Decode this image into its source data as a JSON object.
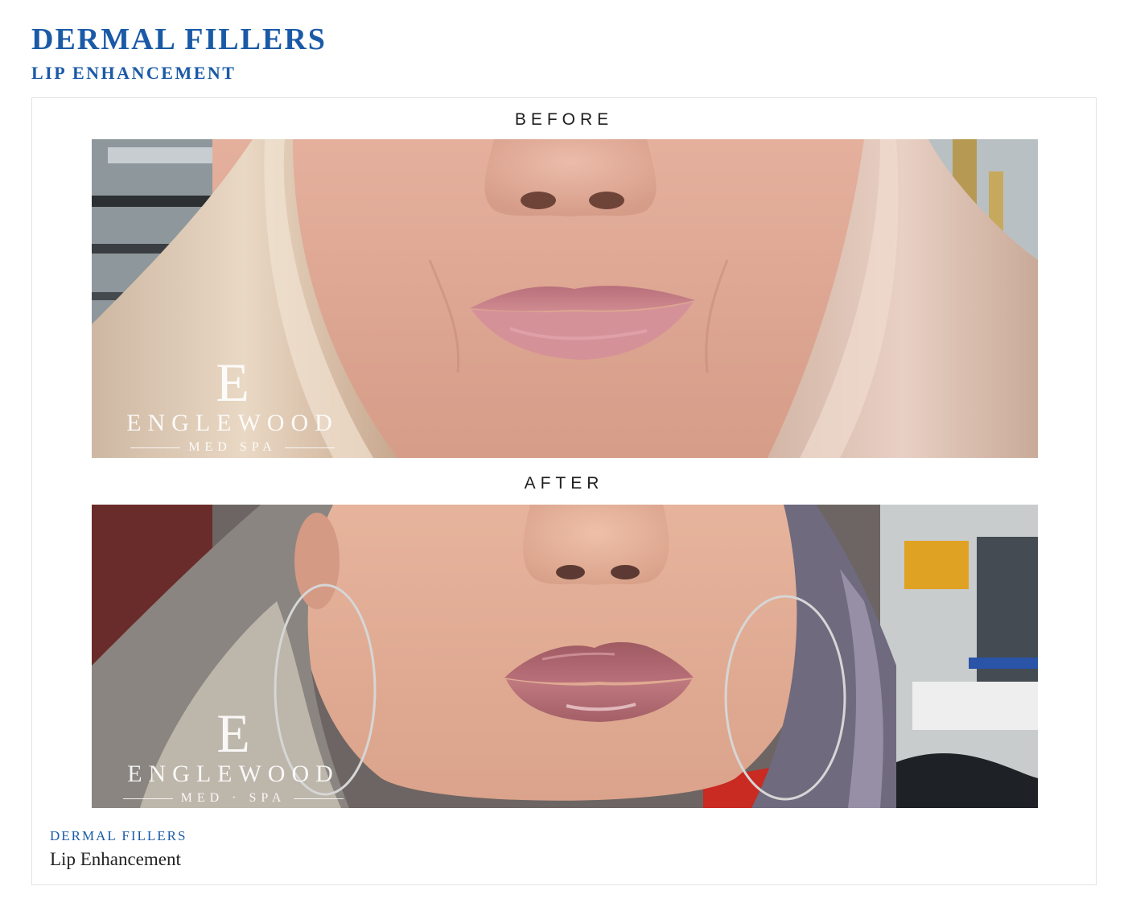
{
  "header": {
    "title": "DERMAL FILLERS",
    "subtitle": "LIP ENHANCEMENT"
  },
  "gallery": {
    "before": {
      "label": "BEFORE",
      "watermark": {
        "letter": "E",
        "name": "ENGLEWOOD",
        "sub": "MED SPA"
      }
    },
    "after": {
      "label": "AFTER",
      "watermark": {
        "letter": "E",
        "name": "ENGLEWOOD",
        "sub": "MED · SPA"
      }
    }
  },
  "caption": {
    "category": "DERMAL FILLERS",
    "title": "Lip Enhancement"
  },
  "colors": {
    "brand_blue": "#1a5aa6",
    "label_text": "#1e1e1e",
    "card_border": "#e2e2e2"
  }
}
